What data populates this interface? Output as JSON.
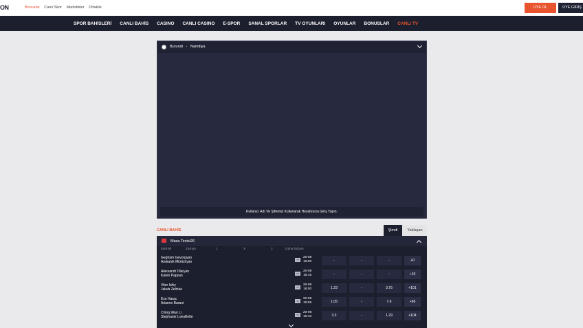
{
  "header": {
    "logo_text": "ON",
    "links": [
      "Bonuslar",
      "Canlı Skor",
      "İstatistikler",
      "Ortaklık"
    ],
    "signup_label": "ÜYE OL",
    "login_label": "ÜYE GİRİŞ"
  },
  "nav": {
    "items": [
      "SPOR BAHİSLERİ",
      "CANLI BAHİS",
      "CASINO",
      "CANLI CASINO",
      "E-SPOR",
      "SANAL SPORLAR",
      "TV OYUNLARI",
      "OYUNLAR",
      "BONUSLAR",
      "CANLI TV"
    ]
  },
  "video": {
    "team_home": "Burundi",
    "separator": "-",
    "team_away": "Namibya",
    "footer_msg": "Kullanıcı Adı Ve Şifrenizi Kullanarak Hesabınıza Giriş Yapın."
  },
  "live": {
    "label": "CANLI BAHİS",
    "tab_now": "Şimdi",
    "tab_soon": "Yaklaşan",
    "sport": "Masa Tenisi26",
    "columns": [
      "Etkinlik",
      "Zaman",
      "1",
      "X",
      "2",
      "Daha fazlası"
    ],
    "rows": [
      {
        "home": "Gegham Gevorgyan",
        "away": "Andranik Mkrtichyan",
        "date": "20-06",
        "hour": "16:00",
        "o1": "-",
        "ox": "-",
        "o2": "-",
        "more": "+0"
      },
      {
        "home": "Aleksandr Olaryan",
        "away": "Karen Papyan",
        "date": "20-06",
        "hour": "16:15",
        "o1": "-",
        "ox": "-",
        "o2": "-",
        "more": "+10"
      },
      {
        "home": "Vitor Ishiy",
        "away": "Jakub Zelinka",
        "date": "20-06",
        "hour": "16:00",
        "o1": "1.23",
        "ox": "-",
        "o2": "3.75",
        "more": "+101"
      },
      {
        "home": "Ece Harac",
        "away": "Arianne Barani",
        "date": "20-06",
        "hour": "15:55",
        "o1": "1.05",
        "ox": "-",
        "o2": "7.6",
        "more": "+96"
      },
      {
        "home": "Ching Wan Li",
        "away": "Stephanie Loeuillette",
        "date": "20-06",
        "hour": "16:10",
        "o1": "3.3",
        "ox": "-",
        "o2": "1.29",
        "more": "+104"
      }
    ]
  }
}
